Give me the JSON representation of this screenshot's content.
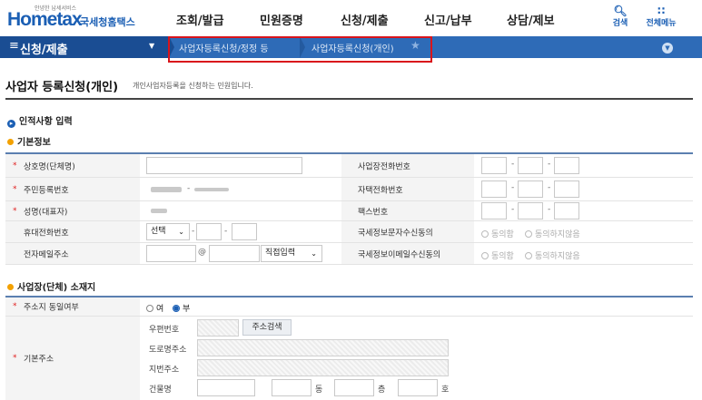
{
  "header": {
    "logo_small": "안녕한 납세서비스",
    "logo_main_home": "Home",
    "logo_main_tax": "tax",
    "logo_ko": "국세청홈택스",
    "gnb": [
      "조회/발급",
      "민원증명",
      "신청/제출",
      "신고/납부",
      "상담/제보"
    ],
    "search_label": "검색",
    "menu_label": "전체메뉴"
  },
  "nav": {
    "home_label": "신청/제출",
    "crumb1": "사업자등록신청/정정 등",
    "crumb2": "사업자등록신청(개인)"
  },
  "page": {
    "title": "사업자 등록신청(개인)",
    "desc": "개인사업자등록을 신청하는 민원입니다."
  },
  "section_personal": {
    "heading": "인적사항 입력",
    "sub": "기본정보",
    "labels": {
      "trade_name": "상호명(단체명)",
      "rrn": "주민등록번호",
      "name": "성명(대표자)",
      "mobile": "휴대전화번호",
      "email": "전자메일주소",
      "biz_phone": "사업장전화번호",
      "home_phone": "자택전화번호",
      "fax": "팩스번호",
      "sms_consent": "국세정보문자수신동의",
      "email_consent": "국세정보이메일수신동의"
    },
    "mobile_select": "선택",
    "email_at": "@",
    "email_domain_select": "직접입력",
    "consent_yes": "동의함",
    "consent_no": "동의하지않음"
  },
  "section_address": {
    "heading": "사업장(단체) 소재지",
    "same_addr_label": "주소지 동일여부",
    "opt_yes": "여",
    "opt_no": "부",
    "basic_addr_label": "기본주소",
    "zip_label": "우편번호",
    "search_btn": "주소검색",
    "road_label": "도로명주소",
    "lot_label": "지번주소",
    "building_label": "건물명",
    "dong": "동",
    "floor": "층",
    "ho": "호"
  },
  "colors": {
    "nav_blue": "#2e6bb7",
    "nav_dark": "#1a4d93",
    "highlight_red": "#d9141b",
    "required_red": "#e02020"
  }
}
